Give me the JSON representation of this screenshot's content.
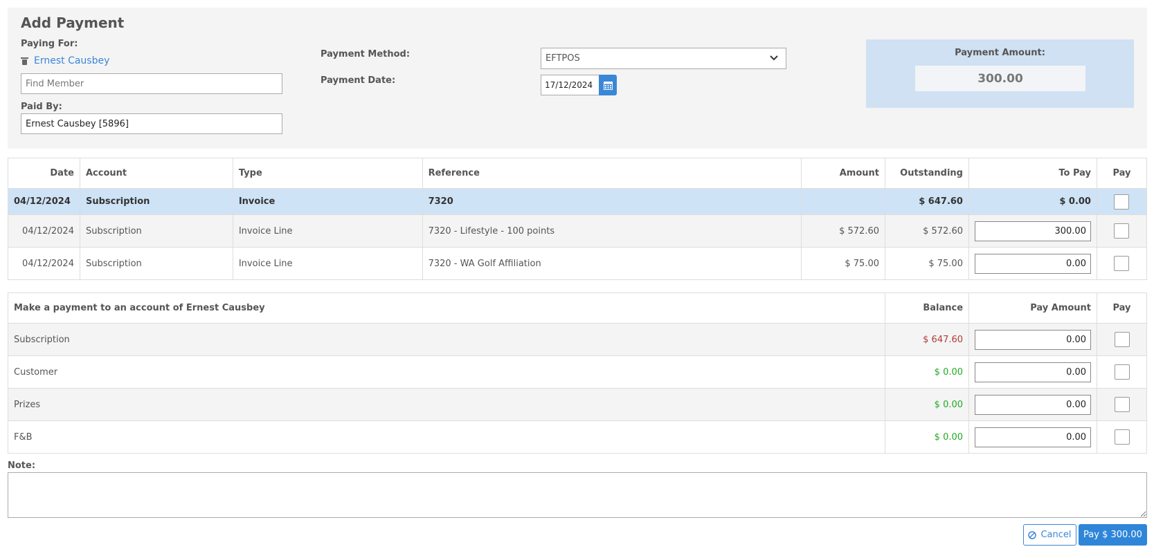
{
  "header": {
    "title": "Add Payment",
    "paying_for_label": "Paying For:",
    "member_name": "Ernest Causbey",
    "find_member_placeholder": "Find Member",
    "paid_by_label": "Paid By:",
    "paid_by_value": "Ernest Causbey [5896]",
    "payment_method_label": "Payment Method:",
    "payment_method_value": "EFTPOS",
    "payment_date_label": "Payment Date:",
    "payment_date_value": "17/12/2024",
    "payment_amount_label": "Payment Amount:",
    "payment_amount_value": "300.00"
  },
  "invoice_table": {
    "headers": {
      "date": "Date",
      "account": "Account",
      "type": "Type",
      "reference": "Reference",
      "amount": "Amount",
      "outstanding": "Outstanding",
      "to_pay": "To Pay",
      "pay": "Pay"
    },
    "invoice_row": {
      "date": "04/12/2024",
      "account": "Subscription",
      "type": "Invoice",
      "reference": "7320",
      "amount": "",
      "outstanding": "$ 647.60",
      "to_pay": "$ 0.00"
    },
    "lines": [
      {
        "date": "04/12/2024",
        "account": "Subscription",
        "type": "Invoice Line",
        "reference": "7320 - Lifestyle - 100 points",
        "amount": "$ 572.60",
        "outstanding": "$ 572.60",
        "to_pay": "300.00"
      },
      {
        "date": "04/12/2024",
        "account": "Subscription",
        "type": "Invoice Line",
        "reference": "7320 - WA Golf Affiliation",
        "amount": "$ 75.00",
        "outstanding": "$ 75.00",
        "to_pay": "0.00"
      }
    ]
  },
  "account_table": {
    "headers": {
      "description": "Make a payment to an account of Ernest Causbey",
      "balance": "Balance",
      "pay_amount": "Pay Amount",
      "pay": "Pay"
    },
    "rows": [
      {
        "account": "Subscription",
        "balance": "$ 647.60",
        "pay_amount": "0.00"
      },
      {
        "account": "Customer",
        "balance": "$ 0.00",
        "pay_amount": "0.00"
      },
      {
        "account": "Prizes",
        "balance": "$ 0.00",
        "pay_amount": "0.00"
      },
      {
        "account": "F&B",
        "balance": "$ 0.00",
        "pay_amount": "0.00"
      }
    ]
  },
  "note_label": "Note:",
  "actions": {
    "cancel_label": "Cancel",
    "pay_label": "Pay $ 300.00"
  },
  "colors": {
    "accent": "#2f86d8",
    "negative": "#b03a3a",
    "positive": "#22aa22",
    "highlight": "#cfe3f6"
  }
}
